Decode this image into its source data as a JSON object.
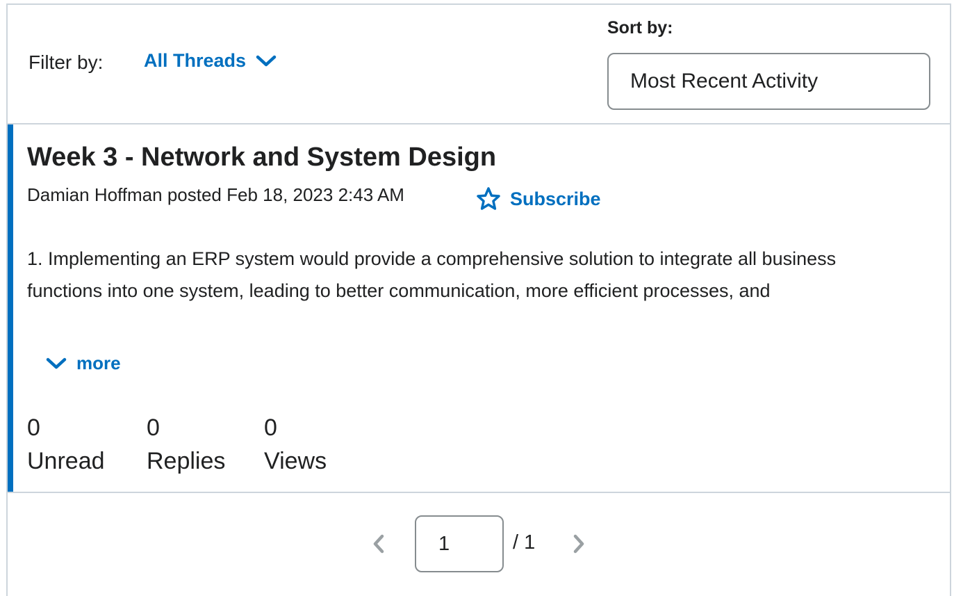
{
  "filters": {
    "filter_label": "Filter by:",
    "filter_value": "All Threads",
    "sort_label": "Sort by:",
    "sort_value": "Most Recent Activity"
  },
  "thread": {
    "title": "Week 3 - Network and System Design",
    "meta": "Damian Hoffman posted Feb 18, 2023 2:43 AM",
    "subscribe_label": "Subscribe",
    "body_line1": "1. Implementing an ERP system would provide a comprehensive solution to integrate all business",
    "body_line2": "functions into one system, leading to better communication, more efficient processes, and",
    "more_label": "more",
    "stats": [
      {
        "value": "0",
        "label": "Unread"
      },
      {
        "value": "0",
        "label": "Replies"
      },
      {
        "value": "0",
        "label": "Views"
      }
    ],
    "accent_color": "#006fbf"
  },
  "pagination": {
    "current_page": "1",
    "total_label": "/ 1"
  },
  "icons": {
    "filter_chevron": "chevron-down-icon",
    "subscribe": "star-outline-icon",
    "more_chevron": "chevron-down-icon",
    "prev": "chevron-left-icon",
    "next": "chevron-right-icon"
  }
}
